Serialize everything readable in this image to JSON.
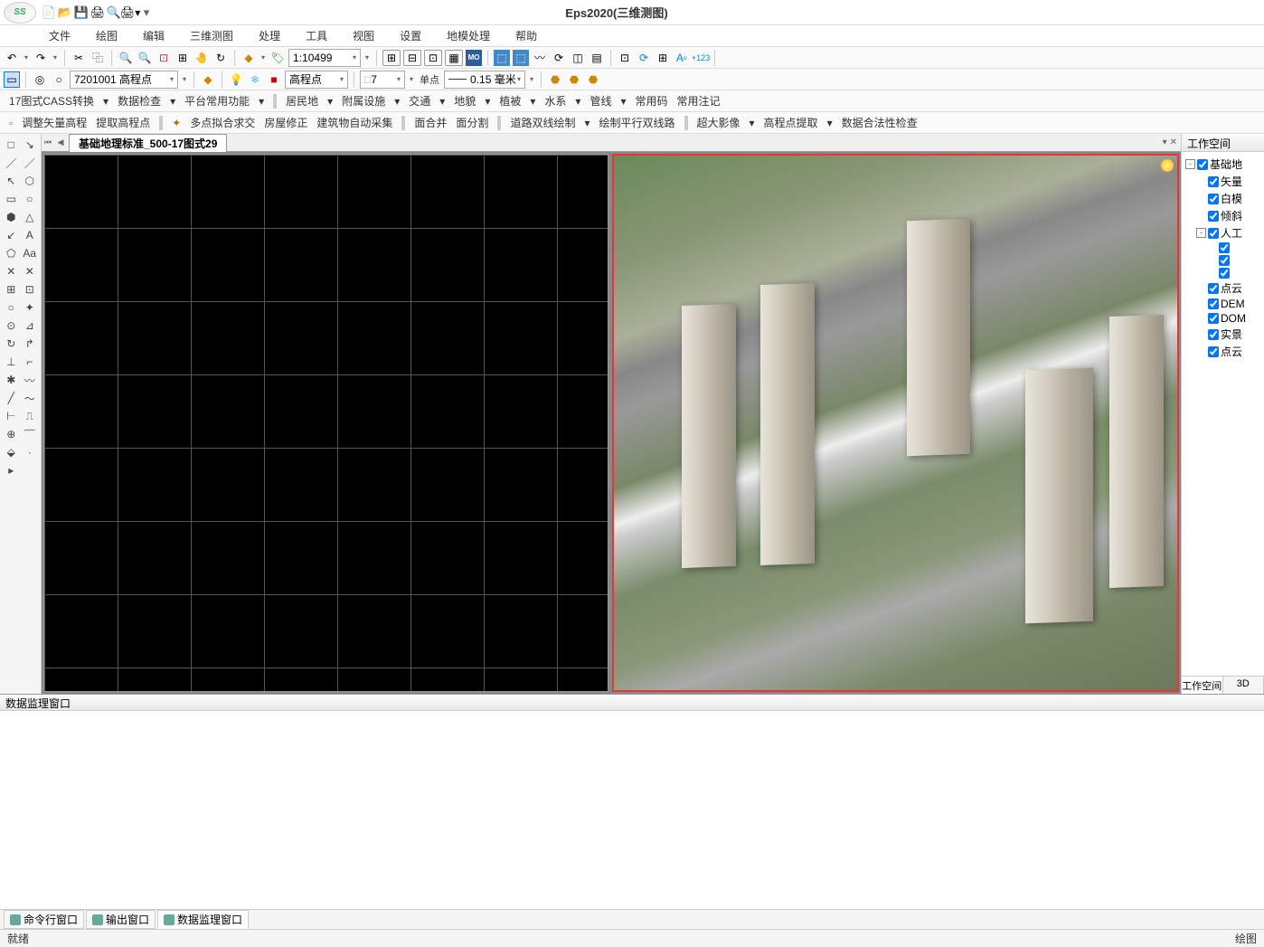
{
  "app": {
    "logo_text": "SS",
    "title": "Eps2020(三维测图)"
  },
  "qat_icons": [
    "new-file-icon",
    "open-icon",
    "save-icon",
    "print-icon",
    "print-preview-icon",
    "print-dropdown-icon"
  ],
  "menu": [
    "文件",
    "绘图",
    "编辑",
    "三维测图",
    "处理",
    "工具",
    "视图",
    "设置",
    "地模处理",
    "帮助"
  ],
  "tb1": {
    "scale_label": "1:10499",
    "mo_label": "MO"
  },
  "tb2": {
    "code_value": "7201001 高程点",
    "layer_value": "高程点",
    "count_value": "7",
    "unit_label": "单点",
    "size_value": "0.15 毫米"
  },
  "cmd1": {
    "items": [
      "17图式CASS转换",
      "数据检查",
      "平台常用功能",
      "居民地",
      "附属设施",
      "交通",
      "地貌",
      "植被",
      "水系",
      "管线",
      "常用码",
      "常用注记"
    ],
    "dropdowns": [
      0,
      1,
      2,
      3,
      4,
      5,
      6,
      7,
      8,
      9
    ]
  },
  "cmd2": {
    "items": [
      "调整矢量高程",
      "提取高程点",
      "多点拟合求交",
      "房屋修正",
      "建筑物自动采集",
      "面合并",
      "面分割",
      "道路双线绘制",
      "绘制平行双线路",
      "超大影像",
      "高程点提取",
      "数据合法性检查"
    ],
    "dropdowns": [
      7,
      9,
      10
    ]
  },
  "left_tool_icons": [
    "□",
    "↘",
    "／",
    "／",
    "↖",
    "⬡",
    "▭",
    "○",
    "⬢",
    "△",
    "↙",
    "A",
    "⬠",
    "Aa",
    "✕",
    "✕",
    "⊞",
    "⊡",
    "○",
    "✦",
    "⊙",
    "⊿",
    "↻",
    "↱",
    "⊥",
    "⌐",
    "✱",
    "〰",
    "╱",
    "〜",
    "⊢",
    "⎍",
    "⊕",
    "﹋",
    "⬙",
    "·",
    "▸"
  ],
  "doc_tab": "基础地理标准_500-17图式29",
  "workspace": {
    "title": "工作空间",
    "nodes": [
      {
        "level": 0,
        "exp": "-",
        "checked": true,
        "label": "基础地"
      },
      {
        "level": 1,
        "exp": "",
        "checked": true,
        "label": "矢量"
      },
      {
        "level": 1,
        "exp": "",
        "checked": true,
        "label": "白模"
      },
      {
        "level": 1,
        "exp": "",
        "checked": true,
        "label": "倾斜"
      },
      {
        "level": 1,
        "exp": "-",
        "checked": true,
        "label": "人工"
      },
      {
        "level": 2,
        "exp": "",
        "checked": true,
        "label": ""
      },
      {
        "level": 2,
        "exp": "",
        "checked": true,
        "label": ""
      },
      {
        "level": 2,
        "exp": "",
        "checked": true,
        "label": ""
      },
      {
        "level": 1,
        "exp": "",
        "checked": true,
        "label": "点云"
      },
      {
        "level": 1,
        "exp": "",
        "checked": true,
        "label": "DEM"
      },
      {
        "level": 1,
        "exp": "",
        "checked": true,
        "label": "DOM"
      },
      {
        "level": 1,
        "exp": "",
        "checked": true,
        "label": "实景"
      },
      {
        "level": 1,
        "exp": "",
        "checked": true,
        "label": "点云"
      }
    ],
    "tabs": [
      "工作空间",
      "3D"
    ]
  },
  "bottom": {
    "title": "数据监理窗口",
    "tabs": [
      "命令行窗口",
      "输出窗口",
      "数据监理窗口"
    ]
  },
  "status": {
    "left": "就绪",
    "right": "绘图"
  }
}
